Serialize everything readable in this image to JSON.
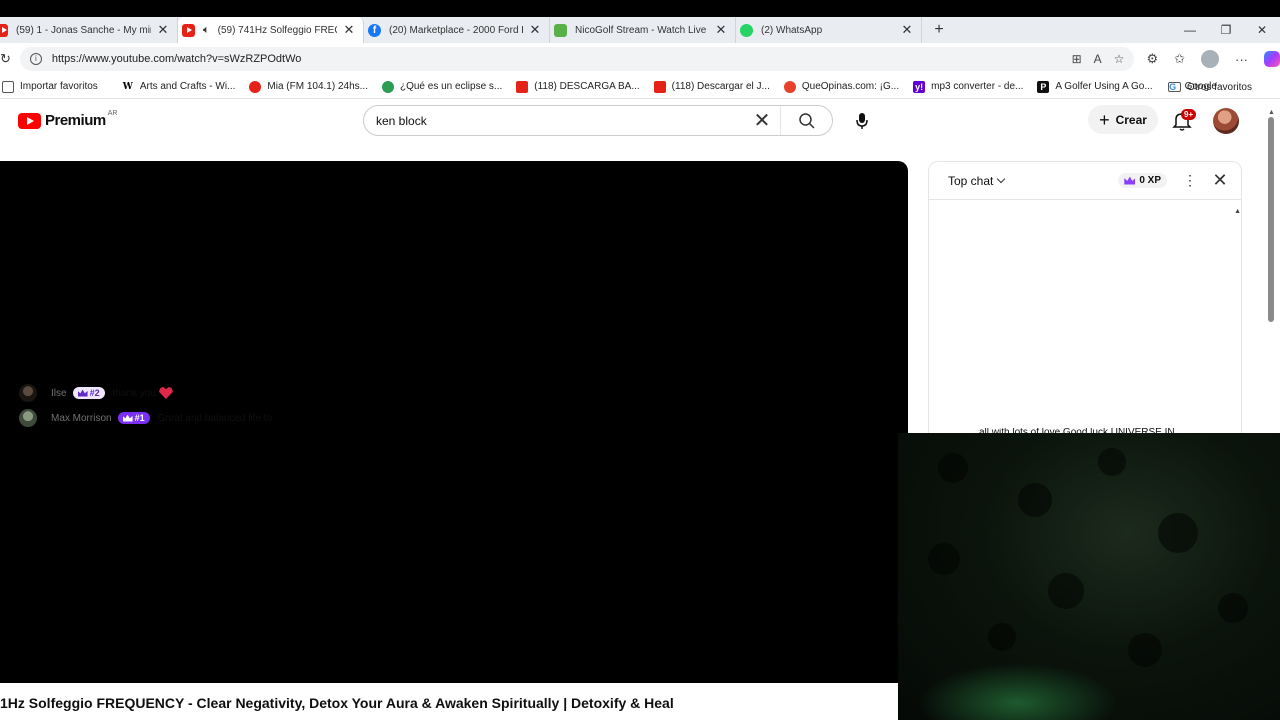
{
  "browser": {
    "tabs": [
      {
        "title": "(59) 1 - Jonas Sanche - My mind",
        "icon": "youtube-icon",
        "active": false
      },
      {
        "title": "(59) 741Hz Solfeggio FREQU",
        "icon": "youtube-icon",
        "active": true,
        "audio": true
      },
      {
        "title": "(20) Marketplace - 2000 Ford Ka",
        "icon": "facebook-icon",
        "active": false
      },
      {
        "title": "NicoGolf Stream - Watch Live on",
        "icon": "nicogolf-icon",
        "active": false
      },
      {
        "title": "(2) WhatsApp",
        "icon": "whatsapp-icon",
        "active": false
      }
    ],
    "url": "https://www.youtube.com/watch?v=sWzRZPOdtWo",
    "bookmarks": [
      {
        "label": "Importar favoritos",
        "icon": "import-icon"
      },
      {
        "label": "Arts and Crafts - Wi...",
        "icon": "wikipedia-icon",
        "glyph": "W"
      },
      {
        "label": "Mia (FM 104.1) 24hs...",
        "icon": "radio-icon"
      },
      {
        "label": "¿Qué es un eclipse s...",
        "icon": "globe-icon"
      },
      {
        "label": "(118) DESCARGA BA...",
        "icon": "youtube-icon"
      },
      {
        "label": "(118) Descargar el J...",
        "icon": "youtube-icon"
      },
      {
        "label": "QueOpinas.com: ¡G...",
        "icon": "queopinas-icon"
      },
      {
        "label": "mp3 converter - de...",
        "icon": "yahoo-icon",
        "glyph": "y!"
      },
      {
        "label": "A Golfer Using A Go...",
        "icon": "golf-icon",
        "glyph": "P"
      },
      {
        "label": "Google",
        "icon": "google-icon",
        "glyph": "G"
      }
    ],
    "other_bookmarks": "Otros favoritos"
  },
  "youtube": {
    "logo_text": "Premium",
    "country_code": "AR",
    "search_value": "ken block",
    "create_label": "Crear",
    "notification_badge": "9+",
    "video_title": "1Hz Solfeggio FREQUENCY - Clear Negativity, Detox Your Aura & Awaken Spiritually | Detoxify & Heal"
  },
  "chat": {
    "mode": "Top chat",
    "xp": "0 XP",
    "messages": [
      {
        "author": "Ilse",
        "rank": "#2",
        "text": "thank you",
        "emoji": "heart"
      },
      {
        "author": "Max Morrison",
        "rank": "#1",
        "text": "Great and balanced life to"
      }
    ],
    "clipped_text": "all with lots of love Good luck UNIVERSE IN"
  },
  "colors": {
    "youtube_red": "#ff0000",
    "rank_purple": "#7b2ff7",
    "badge_red": "#cc0000"
  }
}
